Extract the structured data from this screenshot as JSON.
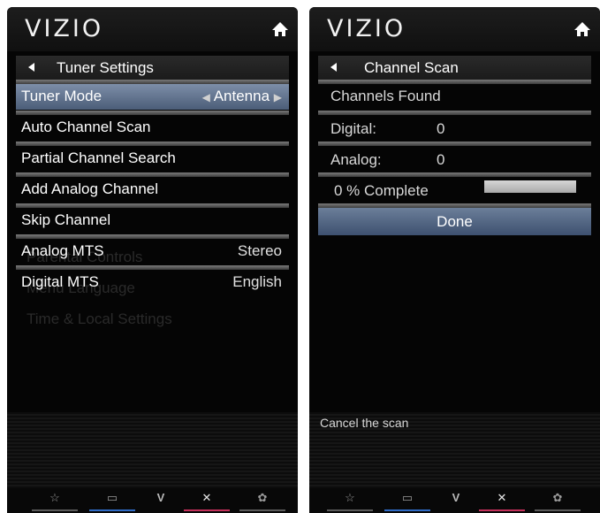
{
  "left": {
    "brand": "VIZIO",
    "title": "Tuner Settings",
    "rows": [
      {
        "label": "Tuner Mode",
        "value": "Antenna"
      },
      {
        "label": "Auto Channel Scan",
        "value": ""
      },
      {
        "label": "Partial Channel Search",
        "value": ""
      },
      {
        "label": "Add Analog Channel",
        "value": ""
      },
      {
        "label": "Skip Channel",
        "value": ""
      },
      {
        "label": "Analog MTS",
        "value": "Stereo"
      },
      {
        "label": "Digital MTS",
        "value": "English"
      }
    ],
    "ghost": [
      "Parental Controls",
      "Name Input",
      "Menu Language",
      "Time & Local Settings"
    ]
  },
  "right": {
    "brand": "VIZIO",
    "title": "Channel Scan",
    "rows": [
      {
        "label": "Channels Found",
        "value": ""
      },
      {
        "label": "Digital:",
        "value": "0"
      },
      {
        "label": "Analog:",
        "value": "0"
      },
      {
        "label": "0 % Complete",
        "value": ""
      }
    ],
    "progress": 0,
    "done_label": "Done",
    "help": "Cancel the scan"
  },
  "footer": {
    "icons": [
      "star-icon",
      "screen-icon",
      "vizio-v-icon",
      "close-icon",
      "gear-icon"
    ],
    "glyphs": [
      "☆",
      "▭",
      "V",
      "✕",
      "✿"
    ],
    "colors": [
      "#5a5a5a",
      "#2f6bc6",
      "#5a5a5a",
      "#c4305a",
      "#5a5a5a"
    ]
  },
  "colors": {
    "selected": "#5b6d88",
    "background": "#050505"
  }
}
